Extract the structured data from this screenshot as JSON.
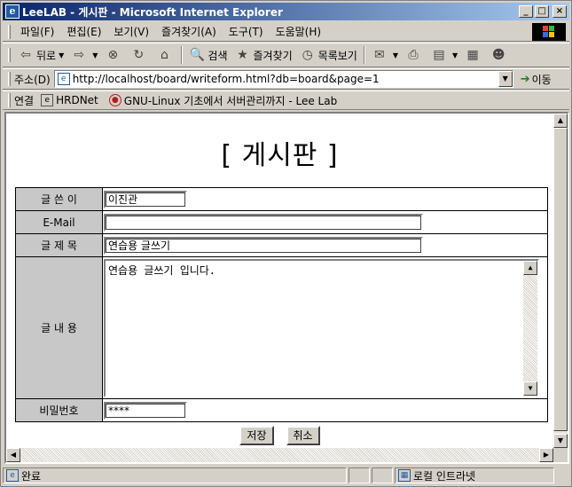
{
  "window": {
    "title": "LeeLAB - 게시판 - Microsoft Internet Explorer",
    "app_icon": "ie-icon",
    "minimize": "_",
    "maximize": "□",
    "close": "×"
  },
  "menu": {
    "items": [
      "파일(F)",
      "편집(E)",
      "보기(V)",
      "즐겨찾기(A)",
      "도구(T)",
      "도움말(H)"
    ]
  },
  "toolbar": {
    "back": "뒤로",
    "search": "검색",
    "favorites": "즐겨찾기",
    "history": "목록보기"
  },
  "address": {
    "label": "주소(D)",
    "url": "http://localhost/board/writeform.html?db=board&page=1",
    "go": "이동"
  },
  "links": {
    "label": "연결",
    "items": [
      {
        "label": "HRDNet",
        "icon": "page-icon"
      },
      {
        "label": "GNU-Linux 기초에서 서버관리까지 - Lee Lab",
        "icon": "site-icon"
      }
    ]
  },
  "page": {
    "title": "[ 게시판 ]",
    "form": {
      "author_label": "글 쓴 이",
      "author_value": "이진관",
      "email_label": "E-Mail",
      "email_value": "",
      "subject_label": "글 제 목",
      "subject_value": "연습용 글쓰기",
      "content_label": "글 내 용",
      "content_value": "연습용 글쓰기 입니다.",
      "password_label": "비밀번호",
      "password_value": "****"
    },
    "buttons": {
      "save": "저장",
      "cancel": "취소"
    }
  },
  "status": {
    "text": "완료",
    "zone": "로컬 인트라넷"
  }
}
